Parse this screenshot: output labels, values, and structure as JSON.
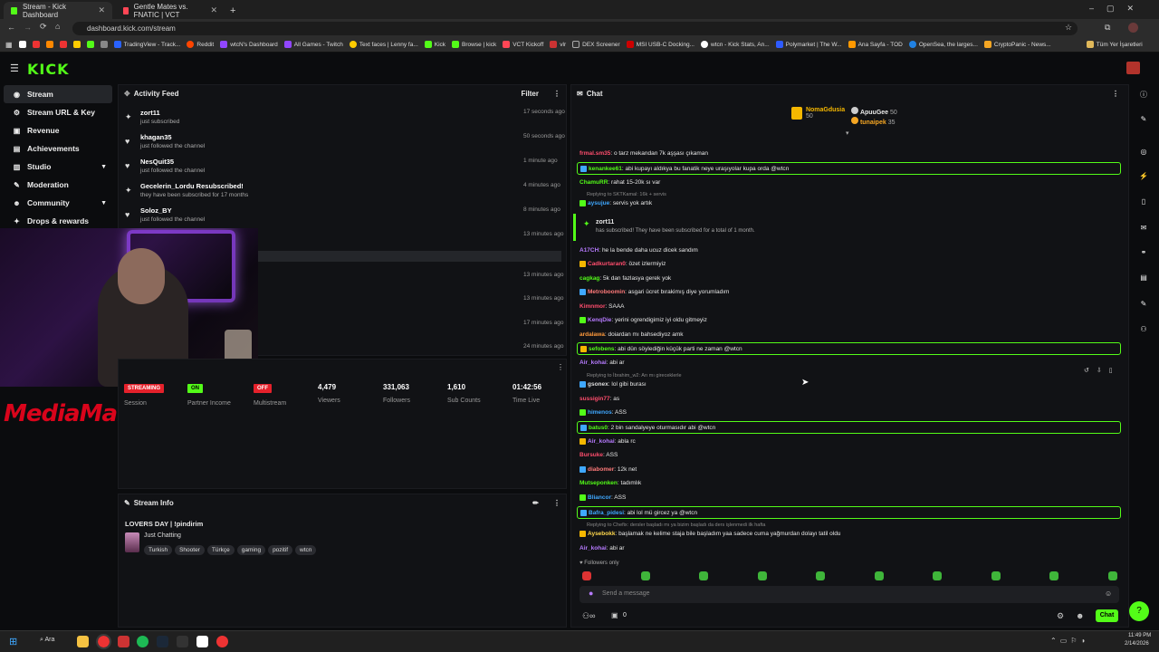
{
  "browser": {
    "tabs": [
      {
        "title": "Stream - Kick Dashboard"
      },
      {
        "title": "Gentle Mates vs. FNATIC | VCT"
      }
    ],
    "url": "dashboard.kick.com/stream",
    "bookmarks": [
      "TradingView - Track...",
      "Reddit",
      "wtcN's Dashboard",
      "All Games - Twitch",
      "Text faces | Lenny fa...",
      "Kick",
      "Browse | kick",
      "VCT Kickoff",
      "vlr",
      "DEX Screener",
      "MSI USB-C Docking...",
      "wtcn - Kick Stats, An...",
      "Polymarket | The W...",
      "Ana Sayfa - TOD",
      "OpenSea, the larges...",
      "CryptoPanic - News..."
    ],
    "all_bookmarks": "Tüm Yer İşaretleri"
  },
  "app": {
    "logo": "KICK"
  },
  "sidebar": {
    "items": [
      {
        "label": "Stream",
        "icon": "broadcast-icon"
      },
      {
        "label": "Stream URL & Key",
        "icon": "key-icon"
      },
      {
        "label": "Revenue",
        "icon": "wallet-icon"
      },
      {
        "label": "Achievements",
        "icon": "trophy-icon"
      },
      {
        "label": "Studio",
        "icon": "studio-icon"
      },
      {
        "label": "Moderation",
        "icon": "shield-icon"
      },
      {
        "label": "Community",
        "icon": "people-icon"
      },
      {
        "label": "Drops & rewards",
        "icon": "gift-icon"
      }
    ]
  },
  "activity": {
    "title": "Activity Feed",
    "filter": "Filter",
    "items": [
      {
        "name": "zort11",
        "desc": "just subscribed",
        "time": "17 seconds ago",
        "icon": "star-icon"
      },
      {
        "name": "khagan35",
        "desc": "just followed the channel",
        "time": "50 seconds ago",
        "icon": "heart-icon"
      },
      {
        "name": "NesQuit35",
        "desc": "just followed the channel",
        "time": "1 minute ago",
        "icon": "heart-icon"
      },
      {
        "name": "Gecelerin_Lordu Resubscribed!",
        "desc": "they have been subscribed for 17 months",
        "time": "4 minutes ago",
        "icon": "star-icon"
      },
      {
        "name": "Soloz_BY",
        "desc": "just followed the channel",
        "time": "8 minutes ago",
        "icon": "heart-icon"
      },
      {
        "name": "",
        "desc": "",
        "time": "13 minutes ago",
        "icon": ""
      },
      {
        "name": "",
        "desc": "",
        "time": "",
        "icon": ""
      },
      {
        "name": "",
        "desc": "",
        "time": "13 minutes ago",
        "icon": ""
      },
      {
        "name": "",
        "desc": "",
        "time": "13 minutes ago",
        "icon": ""
      },
      {
        "name": "",
        "desc": "",
        "time": "17 minutes ago",
        "icon": ""
      },
      {
        "name": "",
        "desc": "",
        "time": "24 minutes ago",
        "icon": ""
      }
    ]
  },
  "overlay": {
    "brand": "MediaMarkt"
  },
  "session": {
    "badges": [
      {
        "text": "STREAMING",
        "label": "Session",
        "color": "#e5212b"
      },
      {
        "text": "ON",
        "label": "Partner Income",
        "color": "#53fc18"
      },
      {
        "text": "OFF",
        "label": "Multistream",
        "color": "#e5212b"
      }
    ],
    "stats": [
      {
        "value": "4,479",
        "label": "Viewers"
      },
      {
        "value": "331,063",
        "label": "Followers"
      },
      {
        "value": "1,610",
        "label": "Sub Counts"
      },
      {
        "value": "01:42:56",
        "label": "Time Live"
      }
    ]
  },
  "stream_info": {
    "title": "Stream Info",
    "stream_title": "LOVERS DAY | !pindirim",
    "category": "Just Chatting",
    "tags": [
      "Turkish",
      "Shooter",
      "Türkçe",
      "gaming",
      "pozitif",
      "wtcn"
    ]
  },
  "chat": {
    "title": "Chat",
    "top_gifters": [
      {
        "name": "NomaGdusia",
        "count": "50"
      },
      {
        "name": "ApuuGee",
        "count": "50"
      },
      {
        "name": "tunaipek",
        "count": "35"
      }
    ],
    "messages": [
      {
        "user": "frmal.sm35",
        "text": "o tarz mekandan 7k aşşası çıkaman",
        "color": "#ff4d6d",
        "hl": false
      },
      {
        "user": "kenankee61",
        "text": "abi kupayı aldıkya bu fanatik neye uraşıyolar kupa orda @wtcn",
        "color": "#53fc18",
        "hl": true
      },
      {
        "user": "ChamuRR",
        "text": "rahat 15-20k sı var",
        "color": "#53fc18",
        "hl": false
      },
      {
        "user": "aysujue",
        "text": "servis yok artık",
        "color": "#3fa8ff",
        "hl": false
      },
      {
        "user": "A17CH",
        "text": "he la bende daha ucuz dicek sandım",
        "color": "#b77bff",
        "hl": false
      },
      {
        "user": "Cadkurtaran0",
        "text": "özet izlermiyiz",
        "color": "#ff4d6d",
        "hl": false
      },
      {
        "user": "cagkag",
        "text": "5k dan fazlasya gerek yok",
        "color": "#53fc18",
        "hl": false
      },
      {
        "user": "Metroboomin",
        "text": "asgari ücret bırakimış diye yorumladım",
        "color": "#ff7a7a",
        "hl": false
      },
      {
        "user": "Kimnmor",
        "text": "SAAA",
        "color": "#ff4d6d",
        "hl": false
      },
      {
        "user": "KenqDie",
        "text": "yerini ogrendigimiz iyi oldu gitmeyiz",
        "color": "#b77bff",
        "hl": false
      },
      {
        "user": "ardalawa",
        "text": "doiardan mı bahsediyoz amk",
        "color": "#ff9a3c",
        "hl": false
      },
      {
        "user": "sefobens",
        "text": "abi dün söylediğin küçük parti ne zaman @wtcn",
        "color": "#53fc18",
        "hl": true
      },
      {
        "user": "Air_kohai",
        "text": "abi ar",
        "color": "#b77bff",
        "hl": false
      },
      {
        "user": "gsonex",
        "text": "lol gibi burası",
        "color": "#dddddd",
        "hl": false
      },
      {
        "user": "sussigin77",
        "text": "as",
        "color": "#ff4d6d",
        "hl": false
      },
      {
        "user": "himenos",
        "text": "ASS",
        "color": "#3fa8ff",
        "hl": false
      },
      {
        "user": "batus0",
        "text": "2 bin sandalyeye oturmasıdır abi @wtcn",
        "color": "#53fc18",
        "hl": true
      },
      {
        "user": "Air_kohai",
        "text": "abla rc",
        "color": "#b77bff",
        "hl": false
      },
      {
        "user": "Bursuke",
        "text": "ASS",
        "color": "#ff4d6d",
        "hl": false
      },
      {
        "user": "diabomer",
        "text": "12k net",
        "color": "#ff7a7a",
        "hl": false
      },
      {
        "user": "Mutseponken",
        "text": "tadımlık",
        "color": "#53fc18",
        "hl": false
      },
      {
        "user": "Bliancor",
        "text": "ASS",
        "color": "#3fa8ff",
        "hl": false
      },
      {
        "user": "Bafra_pidesi",
        "text": "abi lol mü gircez ya @wtcn",
        "color": "#3fa8ff",
        "hl": true
      },
      {
        "user": "Aysebokk",
        "text": "başlamak ne kelime staja bile başladım yaa sadece cuma yağmurdan dolayı tatil oldu",
        "color": "#ffd84d",
        "hl": false
      },
      {
        "user": "Air_kohai",
        "text": "abi ar",
        "color": "#b77bff",
        "hl": false
      }
    ],
    "replies": [
      {
        "text": "Replying to SKTKamal: 16k + servis"
      },
      {
        "text": "Replying to İbrahim_w2: Arı mı gireceklerle"
      },
      {
        "text": "Replying to Chefix: dersler başladı mı ya bizim başladı da ders işlenmedi ilk hafta"
      }
    ],
    "sub_event": {
      "name": "zort11",
      "text": "has subscribed! They have been subscribed for a total of 1 month."
    },
    "followers_only": "Followers only",
    "input_placeholder": "Send a message",
    "chat_button": "Chat",
    "points": "0"
  },
  "taskbar": {
    "search": "Ara",
    "time": "11:49 PM",
    "date": "2/14/2026"
  }
}
